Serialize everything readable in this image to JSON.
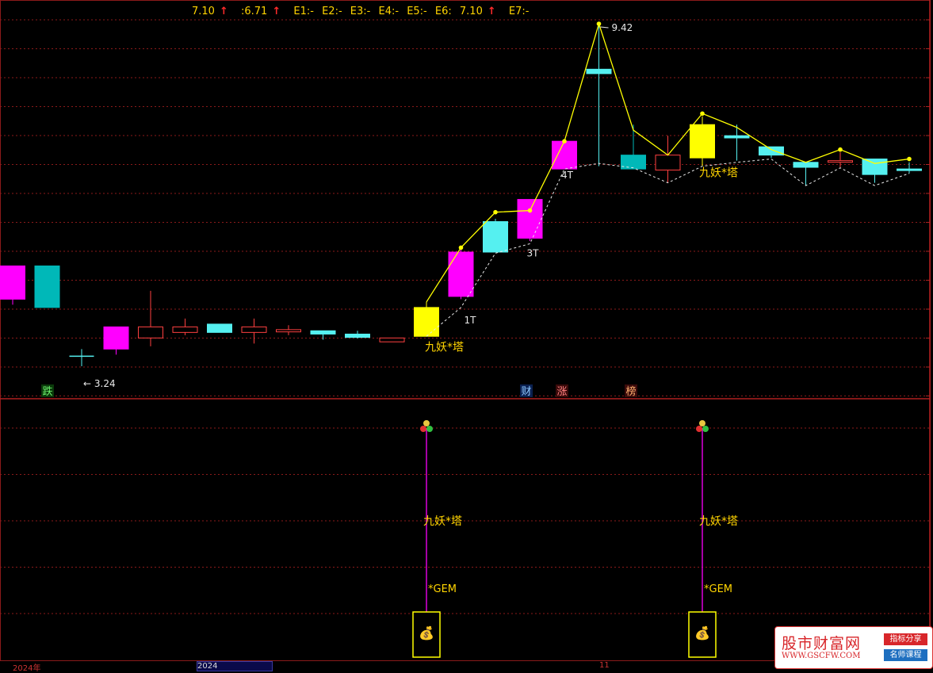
{
  "header": {
    "price_a": "7.10",
    "price_b": ":6.71",
    "e1": "E1:-",
    "e2": "E2:-",
    "e3": "E3:-",
    "e4": "E4:-",
    "e5": "E5:-",
    "e6": "E6:",
    "e6_value": "7.10",
    "e7": "E7:-"
  },
  "colors": {
    "up_magenta": "#ff00ff",
    "cyan": "#55f0f0",
    "teal": "#00b8b8",
    "yellow": "#ffff00",
    "red_hollow": "#ff4040",
    "grid": "#8b1a1a",
    "label_yellow": "#ffd400"
  },
  "main_chart": {
    "high_label": "9.42",
    "low_label": "3.24",
    "markers": {
      "die": "跌",
      "cai": "财",
      "zhang": "涨",
      "bang": "榜"
    },
    "t_labels": [
      "1T",
      "3T",
      "4T"
    ],
    "signal_label": "九妖*塔"
  },
  "lower_panel": {
    "signal_label": "九妖*塔",
    "gem_label": "*GEM",
    "coin_glyph": "💰",
    "cluster_glyph": "●"
  },
  "footer": {
    "year": "2024年",
    "date_box": "2024",
    "mark": "11"
  },
  "brand": {
    "name": "股市财富网",
    "url": "WWW.GSCFW.COM",
    "tag1": "指标分享",
    "tag2": "名师课程"
  },
  "chart_data": {
    "type": "candlestick",
    "ylim": [
      3.0,
      9.6
    ],
    "candles": [
      {
        "o": 5.05,
        "h": 5.05,
        "l": 4.35,
        "c": 4.45,
        "style": "magenta"
      },
      {
        "o": 5.05,
        "h": 5.05,
        "l": 4.3,
        "c": 4.3,
        "style": "teal"
      },
      {
        "o": 3.42,
        "h": 3.55,
        "l": 3.24,
        "c": 3.42,
        "style": "cross"
      },
      {
        "o": 3.55,
        "h": 3.95,
        "l": 3.45,
        "c": 3.95,
        "style": "magenta"
      },
      {
        "o": 3.95,
        "h": 4.6,
        "l": 3.6,
        "c": 3.75,
        "style": "red_hollow"
      },
      {
        "o": 3.95,
        "h": 4.1,
        "l": 3.8,
        "c": 3.85,
        "style": "red_hollow"
      },
      {
        "o": 4.0,
        "h": 4.0,
        "l": 3.85,
        "c": 3.85,
        "style": "cyan"
      },
      {
        "o": 3.95,
        "h": 4.1,
        "l": 3.65,
        "c": 3.85,
        "style": "red_hollow"
      },
      {
        "o": 3.9,
        "h": 3.98,
        "l": 3.8,
        "c": 3.86,
        "style": "red_hollow"
      },
      {
        "o": 3.88,
        "h": 3.88,
        "l": 3.72,
        "c": 3.82,
        "style": "cyan"
      },
      {
        "o": 3.82,
        "h": 3.88,
        "l": 3.74,
        "c": 3.76,
        "style": "cyan"
      },
      {
        "o": 3.75,
        "h": 3.75,
        "l": 3.68,
        "c": 3.68,
        "style": "red_hollow"
      },
      {
        "o": 3.78,
        "h": 4.4,
        "l": 3.78,
        "c": 4.3,
        "style": "yellow"
      },
      {
        "o": 4.5,
        "h": 5.4,
        "l": 4.45,
        "c": 5.3,
        "style": "magenta"
      },
      {
        "o": 5.3,
        "h": 5.9,
        "l": 5.3,
        "c": 5.85,
        "style": "cyan"
      },
      {
        "o": 5.55,
        "h": 6.25,
        "l": 5.5,
        "c": 6.25,
        "style": "magenta"
      },
      {
        "o": 6.8,
        "h": 7.3,
        "l": 6.8,
        "c": 7.3,
        "style": "magenta"
      },
      {
        "o": 8.6,
        "h": 9.42,
        "l": 6.85,
        "c": 8.52,
        "style": "cyan"
      },
      {
        "o": 7.05,
        "h": 7.6,
        "l": 6.8,
        "c": 6.8,
        "style": "teal"
      },
      {
        "o": 7.05,
        "h": 7.4,
        "l": 6.55,
        "c": 6.78,
        "style": "red_hollow"
      },
      {
        "o": 7.0,
        "h": 7.75,
        "l": 6.85,
        "c": 7.6,
        "style": "yellow"
      },
      {
        "o": 7.4,
        "h": 7.6,
        "l": 6.95,
        "c": 7.36,
        "style": "cyan"
      },
      {
        "o": 7.2,
        "h": 7.2,
        "l": 7.0,
        "c": 7.05,
        "style": "cyan"
      },
      {
        "o": 6.92,
        "h": 6.92,
        "l": 6.5,
        "c": 6.83,
        "style": "cyan"
      },
      {
        "o": 6.95,
        "h": 7.1,
        "l": 6.83,
        "c": 6.95,
        "style": "red_hollow"
      },
      {
        "o": 6.98,
        "h": 6.98,
        "l": 6.55,
        "c": 6.7,
        "style": "cyan"
      },
      {
        "o": 6.8,
        "h": 6.92,
        "l": 6.72,
        "c": 6.78,
        "style": "cyan"
      }
    ]
  }
}
